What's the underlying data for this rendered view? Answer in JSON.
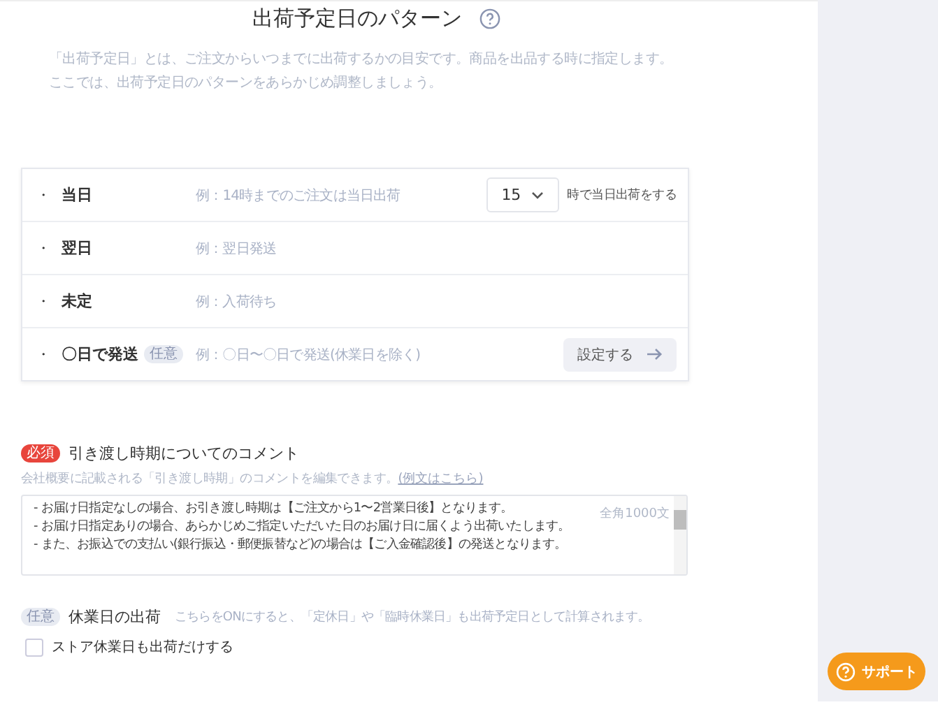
{
  "header": {
    "title": "出荷予定日のパターン",
    "description": [
      "「出荷予定日」とは、ご注文からいつまでに出荷するかの目安です。商品を出品する時に指定します。",
      "ここでは、出荷予定日のパターンをあらかじめ調整しましょう。"
    ]
  },
  "patterns": [
    {
      "kind": "select",
      "bullet": "・",
      "label": "当日",
      "example": "例：14時までのご注文は当日出荷",
      "select_value": "15",
      "suffix": "時で当日出荷をする"
    },
    {
      "kind": "plain",
      "bullet": "・",
      "label": "翌日",
      "example": "例：翌日発送"
    },
    {
      "kind": "plain",
      "bullet": "・",
      "label": "未定",
      "example": "例：入荷待ち"
    },
    {
      "kind": "button",
      "bullet": "・",
      "label": "〇日で発送",
      "badge": "任意",
      "example": "例：〇日〜〇日で発送(休業日を除く)",
      "button": "設定する"
    }
  ],
  "comment": {
    "badge": "必須",
    "title": "引き渡し時期についてのコメント",
    "hint": "会社概要に記載される「引き渡し時期」のコメントを編集できます。",
    "link": "(例文はこちら)",
    "lines": [
      "- お届け日指定なしの場合、お引き渡し時期は【ご注文から1〜2営業日後】となります。",
      "- お届け日指定ありの場合、あらかじめご指定いただいた日のお届け日に届くよう出荷いたします。",
      "- また、お振込での支払い(銀行振込・郵便振替など)の場合は【ご入金確認後】の発送となります。"
    ],
    "counter": "全角1000文"
  },
  "holiday": {
    "badge": "任意",
    "title": "休業日の出荷",
    "hint": "こちらをONにすると、「定休日」や「臨時休業日」も出荷予定日として計算されます。",
    "checkbox": {
      "label": "ストア休業日も出荷だけする",
      "checked": false
    }
  },
  "support_button": "サポート"
}
